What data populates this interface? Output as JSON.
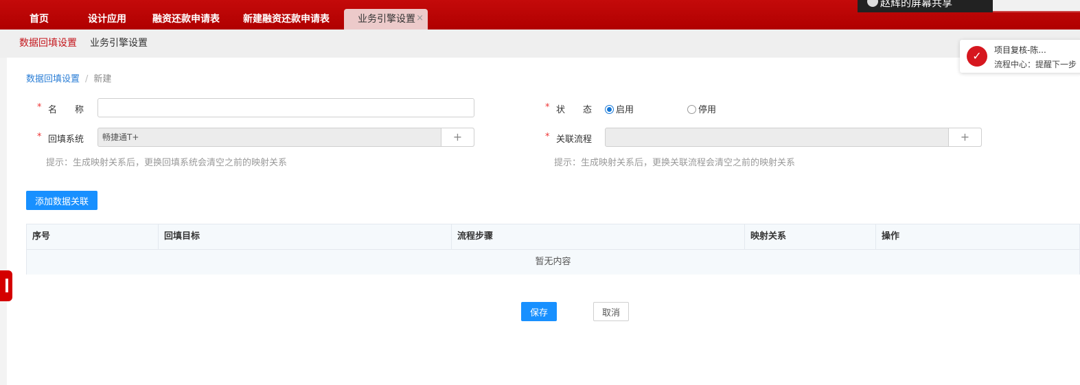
{
  "top_tabs": [
    {
      "label": "首页"
    },
    {
      "label": "设计应用"
    },
    {
      "label": "融资还款申请表"
    },
    {
      "label": "新建融资还款申请表"
    },
    {
      "label": "业务引擎设置",
      "active": true
    }
  ],
  "tab_close_glyph": "×",
  "screen_share_label": "赵辉的屏幕共享",
  "sub_nav": [
    {
      "label": "数据回填设置",
      "active": true
    },
    {
      "label": "业务引擎设置"
    }
  ],
  "notification": {
    "title": "项目复核-陈...",
    "text": "流程中心：提醒下一步",
    "icon": "approval-icon"
  },
  "breadcrumb": {
    "parent": "数据回填设置",
    "separator": "/",
    "current": "新建"
  },
  "form": {
    "name_label": "名　　称",
    "name_value": "",
    "status_label": "状　　态",
    "status_options": [
      "启用",
      "停用"
    ],
    "status_selected": "启用",
    "fill_system_label": "回填系统",
    "fill_system_value": "畅捷通T+",
    "related_flow_label": "关联流程",
    "related_flow_value": "",
    "plus_glyph": "+",
    "required_mark": "*",
    "fill_system_hint": "提示：生成映射关系后，更换回填系统会清空之前的映射关系",
    "related_flow_hint": "提示：生成映射关系后，更换关联流程会清空之前的映射关系"
  },
  "add_button_label": "添加数据关联",
  "table": {
    "columns": [
      "序号",
      "回填目标",
      "流程步骤",
      "映射关系",
      "操作"
    ],
    "empty_text": "暂无内容"
  },
  "actions": {
    "save_label": "保存",
    "cancel_label": "取消"
  },
  "colors": {
    "brand_red": "#c4161c",
    "primary_blue": "#1890ff",
    "link_blue": "#2a7ed6"
  }
}
